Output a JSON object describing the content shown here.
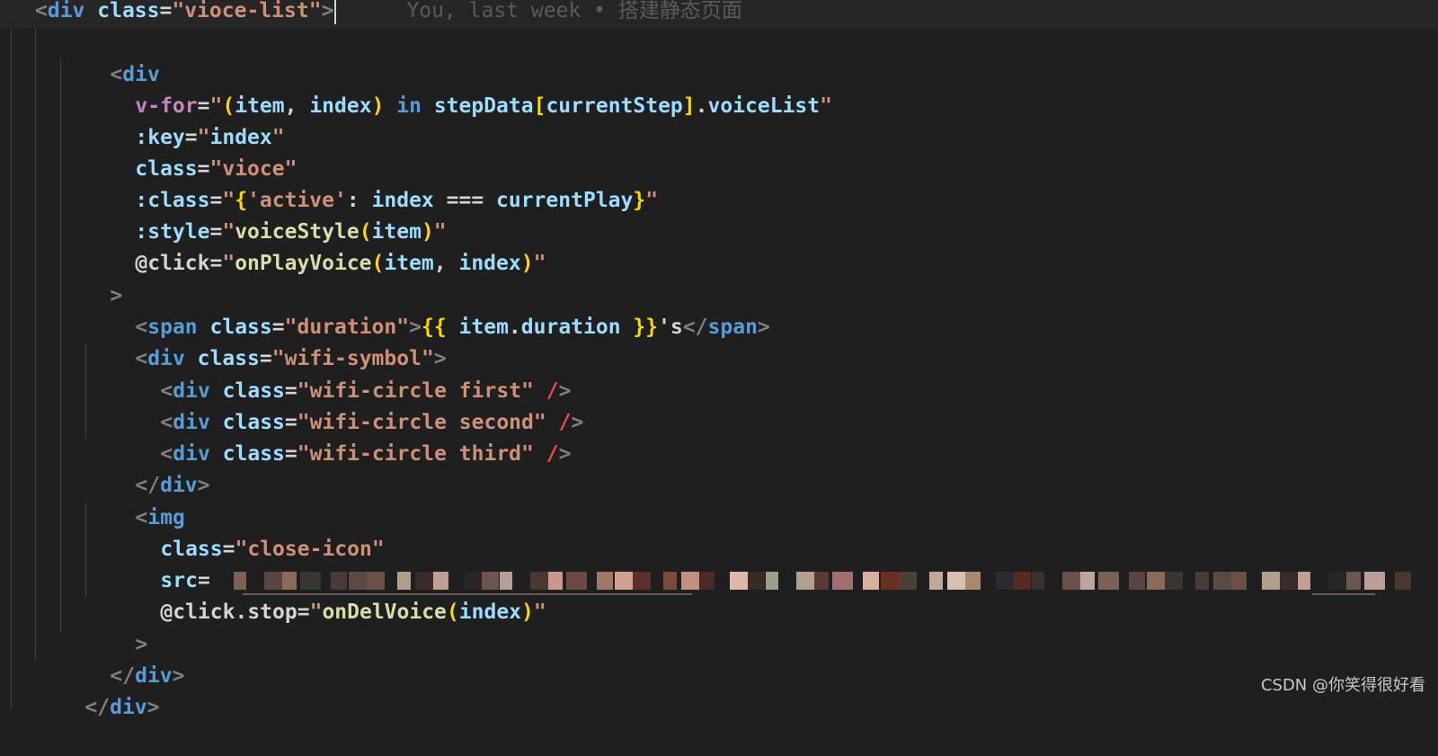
{
  "editor": {
    "line1": {
      "open": "<",
      "tag": "div",
      "attr": "class",
      "eq": "=",
      "q": "\"",
      "val": "vioce-list",
      "close": ">"
    },
    "blame": "You, last week • 搭建静态页面",
    "line2": {
      "open": "<",
      "tag": "div"
    },
    "line3": {
      "attr": "v-for",
      "eq": "=",
      "q": "\"",
      "p1": "(",
      "item": "item",
      "comma": ", ",
      "index": "index",
      "p2": ")",
      "in": " in ",
      "stepData": "stepData",
      "b1": "[",
      "currentStep": "currentStep",
      "b2": "]",
      "dot": ".",
      "voiceList": "voiceList"
    },
    "line4": {
      "attr": ":key",
      "eq": "=",
      "q": "\"",
      "val": "index"
    },
    "line5": {
      "attr": "class",
      "eq": "=",
      "q": "\"",
      "val": "vioce"
    },
    "line6": {
      "attr": ":class",
      "eq": "=",
      "q": "\"",
      "brace1": "{",
      "key": "'active'",
      "colon": ": ",
      "index": "index",
      "op": " === ",
      "currentPlay": "currentPlay",
      "brace2": "}"
    },
    "line7": {
      "attr": ":style",
      "eq": "=",
      "q": "\"",
      "fn": "voiceStyle",
      "p1": "(",
      "item": "item",
      "p2": ")"
    },
    "line8": {
      "attr": "@click",
      "eq": "=",
      "q": "\"",
      "fn": "onPlayVoice",
      "p1": "(",
      "item": "item",
      "comma": ", ",
      "index": "index",
      "p2": ")"
    },
    "line9": {
      "close": ">"
    },
    "line10": {
      "open": "<",
      "tag": "span",
      "attr": "class",
      "eq": "=",
      "q": "\"",
      "val": "duration",
      "close": ">",
      "m1": "{{",
      "item": "item",
      "dot": ".",
      "duration": "duration",
      "m2": "}}",
      "suffix": "'s",
      "endopen": "</",
      "endtag": "span",
      "endclose": ">"
    },
    "line11": {
      "open": "<",
      "tag": "div",
      "attr": "class",
      "eq": "=",
      "q": "\"",
      "val": "wifi-symbol",
      "close": ">"
    },
    "line12": {
      "open": "<",
      "tag": "div",
      "attr": "class",
      "eq": "=",
      "q": "\"",
      "val": "wifi-circle first",
      "slash": "/",
      "close": ">"
    },
    "line13": {
      "open": "<",
      "tag": "div",
      "attr": "class",
      "eq": "=",
      "q": "\"",
      "val": "wifi-circle second",
      "slash": "/",
      "close": ">"
    },
    "line14": {
      "open": "<",
      "tag": "div",
      "attr": "class",
      "eq": "=",
      "q": "\"",
      "val": "wifi-circle third",
      "slash": "/",
      "close": ">"
    },
    "line15": {
      "open": "</",
      "tag": "div",
      "close": ">"
    },
    "line16": {
      "open": "<",
      "tag": "img"
    },
    "line17": {
      "attr": "class",
      "eq": "=",
      "q": "\"",
      "val": "close-icon"
    },
    "line18": {
      "attr": "src",
      "eq": "= "
    },
    "line19": {
      "attr": "@click.stop",
      "eq": "=",
      "q": "\"",
      "fn": "onDelVoice",
      "p1": "(",
      "index": "index",
      "p2": ")"
    },
    "line20": {
      "close": ">"
    },
    "line21": {
      "open": "</",
      "tag": "div",
      "close": ">"
    },
    "line22": {
      "open": "</",
      "tag": "div",
      "close": ">"
    }
  },
  "mosaic_colors": [
    "#7a6055",
    "#5a4540",
    "#8a6a5a",
    "#3a3530",
    "#4a3a35",
    "#5a4a45",
    "#6a5045",
    "#b0a08a",
    "#3a2a2a",
    "#c0a090",
    "#2a2525",
    "#6a5550",
    "#b8a098",
    "#4a3830",
    "#c89888",
    "#6a4a40",
    "#a07868",
    "#d0a090",
    "#5a3028",
    "#7a4a3a",
    "#c09080",
    "#4a2a28",
    "#e0b8a8",
    "#3a2a25",
    "#98a088",
    "#b0a090",
    "#5a3a35",
    "#a07070",
    "#d8b0a0",
    "#6a3020",
    "#4a4035",
    "#c0a898",
    "#d8c0b0",
    "#a88870",
    "#2a2a30",
    "#5a2a20",
    "#3a3030",
    "#6a5048",
    "#b8a8a0"
  ],
  "watermark": "CSDN @你笑得很好看"
}
